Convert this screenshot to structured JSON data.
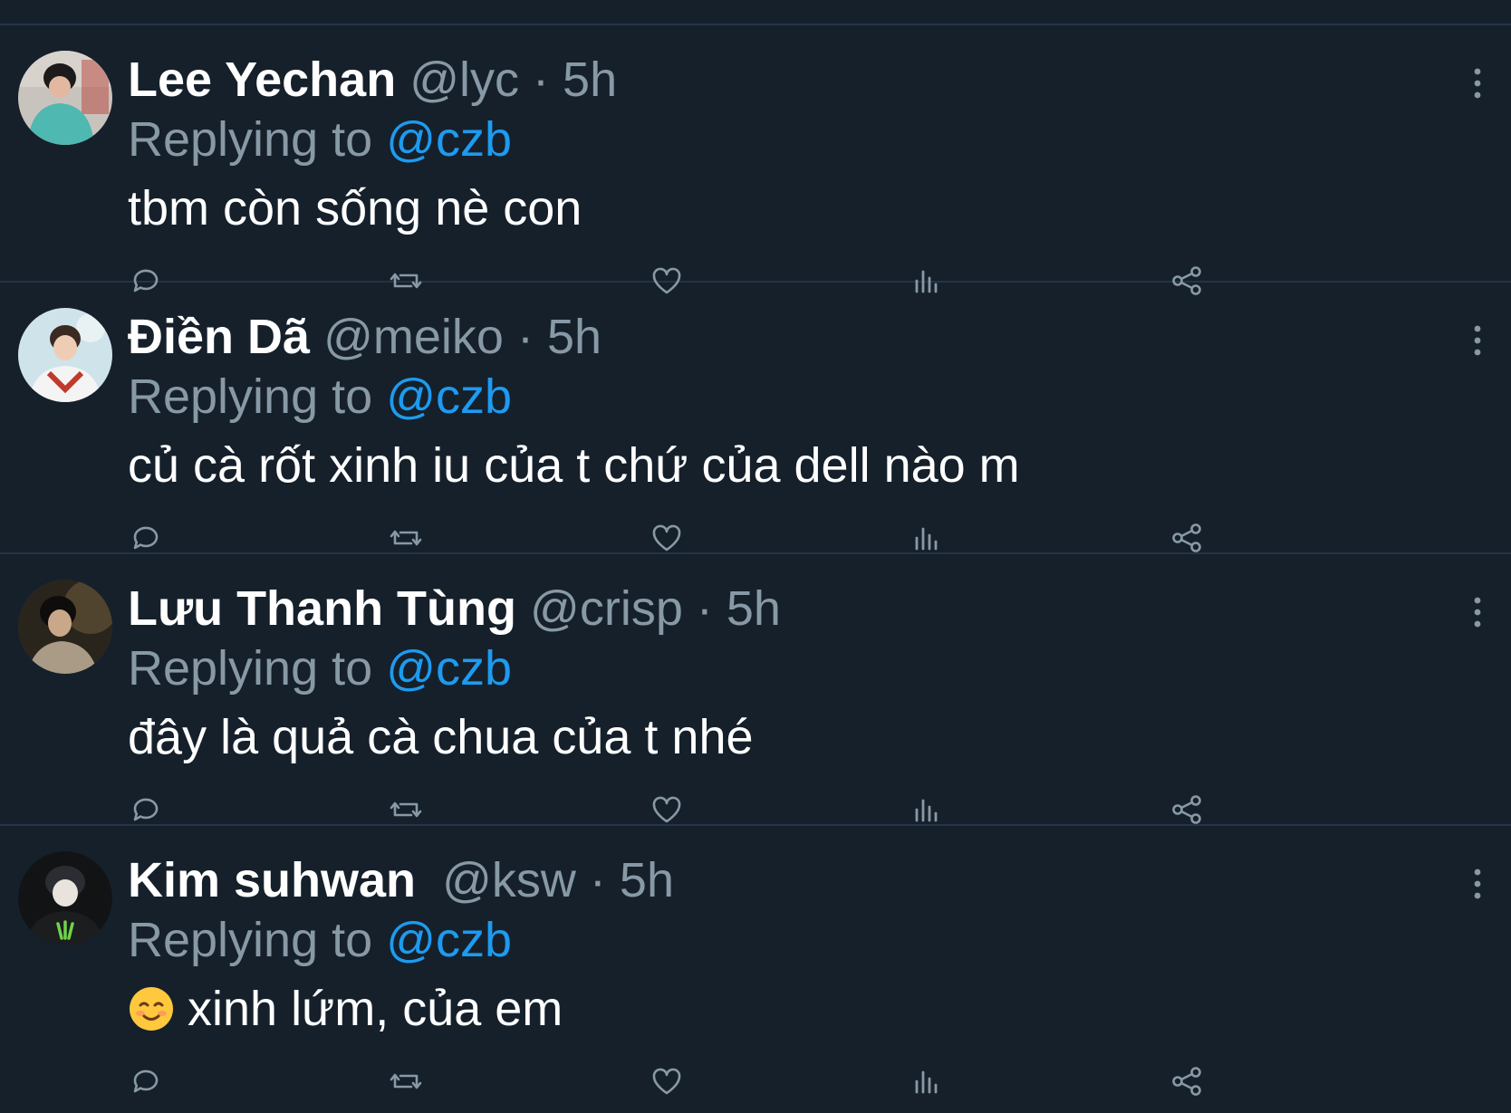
{
  "colors": {
    "background": "#15202b",
    "divider": "#243447",
    "secondary_text": "#8899a6",
    "link": "#1d9bf0",
    "primary_text": "#ffffff"
  },
  "replies": [
    {
      "display_name": "Lee Yechan",
      "handle": "@lyc",
      "separator": "·",
      "time": "5h",
      "replying_label": "Replying to",
      "replying_to": "@czb",
      "text": "tbm còn sống nè con",
      "emoji": ""
    },
    {
      "display_name": "Điền Dã",
      "handle": "@meiko",
      "separator": "·",
      "time": "5h",
      "replying_label": "Replying to",
      "replying_to": "@czb",
      "text": "củ cà rốt xinh iu của t chứ của dell nào m",
      "emoji": ""
    },
    {
      "display_name": "Lưu Thanh Tùng",
      "handle": "@crisp",
      "separator": "·",
      "time": "5h",
      "replying_label": "Replying to",
      "replying_to": "@czb",
      "text": "đây là quả cà chua của t nhé",
      "emoji": ""
    },
    {
      "display_name": "Kim suhwan",
      "handle": "@ksw",
      "separator": "·",
      "time": "5h",
      "replying_label": "Replying to",
      "replying_to": "@czb",
      "text": "xinh lứm, của em",
      "emoji": "smiling-face-icon"
    }
  ],
  "action_icons": [
    "reply-icon",
    "retweet-icon",
    "like-icon",
    "views-icon",
    "share-icon"
  ]
}
